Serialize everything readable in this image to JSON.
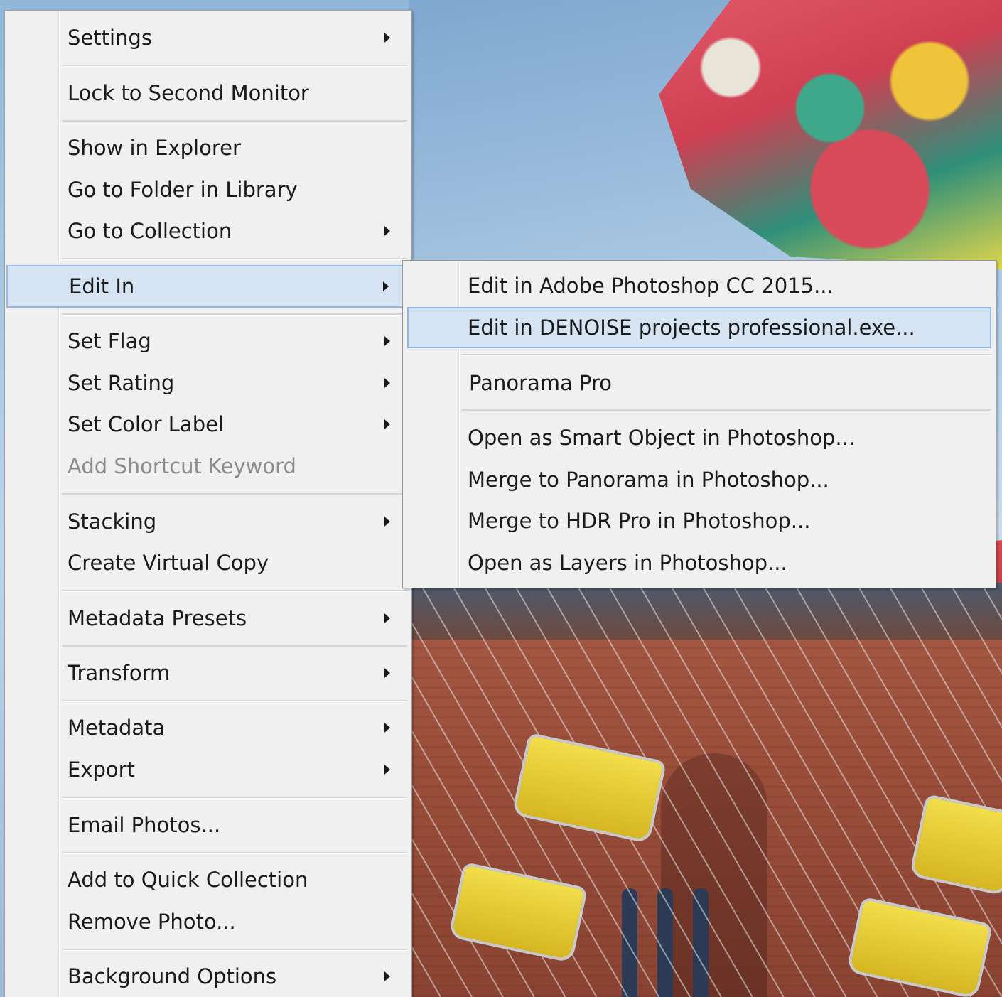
{
  "main_menu": {
    "items": [
      {
        "label": "Settings",
        "submenu": true
      },
      {
        "label": "Lock to Second Monitor",
        "submenu": false
      },
      {
        "label": "Show in Explorer",
        "submenu": false
      },
      {
        "label": "Go to Folder in Library",
        "submenu": false
      },
      {
        "label": "Go to Collection",
        "submenu": true
      },
      {
        "label": "Edit In",
        "submenu": true,
        "highlighted": true
      },
      {
        "label": "Set Flag",
        "submenu": true
      },
      {
        "label": "Set Rating",
        "submenu": true
      },
      {
        "label": "Set Color Label",
        "submenu": true
      },
      {
        "label": "Add Shortcut Keyword",
        "submenu": false,
        "disabled": true
      },
      {
        "label": "Stacking",
        "submenu": true
      },
      {
        "label": "Create Virtual Copy",
        "submenu": false
      },
      {
        "label": "Metadata Presets",
        "submenu": true
      },
      {
        "label": "Transform",
        "submenu": true
      },
      {
        "label": "Metadata",
        "submenu": true
      },
      {
        "label": "Export",
        "submenu": true
      },
      {
        "label": "Email Photos...",
        "submenu": false
      },
      {
        "label": "Add to Quick Collection",
        "submenu": false
      },
      {
        "label": "Remove Photo...",
        "submenu": false
      },
      {
        "label": "Background Options",
        "submenu": true
      }
    ]
  },
  "edit_in_submenu": {
    "items": [
      {
        "label": "Edit in Adobe Photoshop CC 2015..."
      },
      {
        "label": "Edit in DENOISE projects professional.exe...",
        "highlighted": true
      },
      {
        "label": "Panorama Pro"
      },
      {
        "label": "Open as Smart Object in Photoshop..."
      },
      {
        "label": "Merge to Panorama in Photoshop..."
      },
      {
        "label": "Merge to HDR Pro in Photoshop..."
      },
      {
        "label": "Open as Layers in Photoshop..."
      }
    ]
  },
  "colors": {
    "menu_background": "#f0f0f0",
    "highlight_fill": "#d5e3f3",
    "highlight_border": "#94b8e6",
    "disabled_text": "#8c8c8c"
  },
  "icons": {
    "submenu_arrow": "chevron-right-icon"
  }
}
